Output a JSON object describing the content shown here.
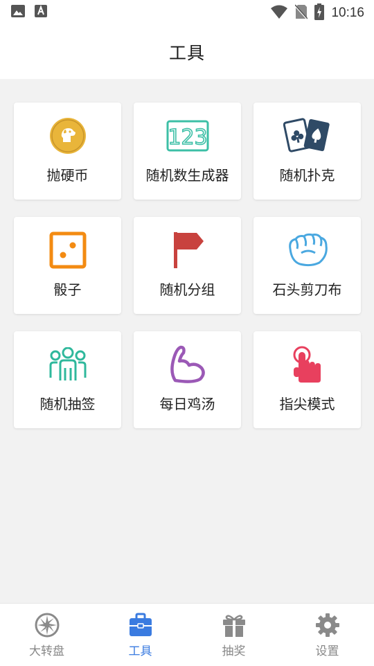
{
  "status_bar": {
    "time": "10:16"
  },
  "header": {
    "title": "工具"
  },
  "tools": [
    {
      "label": "抛硬币",
      "icon": "coin-dog-icon"
    },
    {
      "label": "随机数生成器",
      "icon": "number-123-icon"
    },
    {
      "label": "随机扑克",
      "icon": "playing-cards-icon"
    },
    {
      "label": "骰子",
      "icon": "dice-icon"
    },
    {
      "label": "随机分组",
      "icon": "flag-icon"
    },
    {
      "label": "石头剪刀布",
      "icon": "fist-icon"
    },
    {
      "label": "随机抽签",
      "icon": "people-group-icon"
    },
    {
      "label": "每日鸡汤",
      "icon": "muscle-arm-icon"
    },
    {
      "label": "指尖模式",
      "icon": "finger-tap-icon"
    }
  ],
  "icon_colors": {
    "coin": "#e9b53a",
    "number": "#3cbfa6",
    "cards": "#2f4a66",
    "dice": "#f38b12",
    "flag": "#c8423e",
    "fist": "#4aa8e0",
    "group": "#2fb89c",
    "muscle": "#9b59b6",
    "finger": "#e8405e"
  },
  "bottom_nav": {
    "items": [
      {
        "label": "大转盘",
        "icon": "wheel-icon",
        "active": false
      },
      {
        "label": "工具",
        "icon": "toolbox-icon",
        "active": true
      },
      {
        "label": "抽奖",
        "icon": "gift-icon",
        "active": false
      },
      {
        "label": "设置",
        "icon": "gear-icon",
        "active": false
      }
    ],
    "active_color": "#3a7be0",
    "inactive_color": "#8a8a8a"
  }
}
